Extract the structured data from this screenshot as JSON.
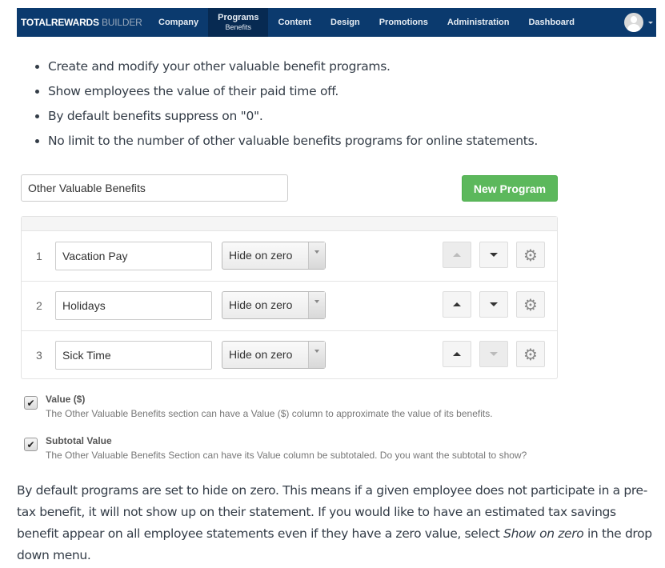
{
  "navbar": {
    "brand_primary": "TOTALREWARDS",
    "brand_secondary": "BUILDER",
    "items": [
      {
        "label": "Company"
      },
      {
        "label": "Programs",
        "sublabel": "Benefits",
        "active": true
      },
      {
        "label": "Content"
      },
      {
        "label": "Design"
      },
      {
        "label": "Promotions"
      },
      {
        "label": "Administration"
      },
      {
        "label": "Dashboard"
      }
    ]
  },
  "bullets": [
    "Create and modify your other valuable benefit programs.",
    "Show employees the value of their paid time off.",
    "By default benefits suppress on \"0\".",
    "No limit to the number of other valuable benefits programs for online statements."
  ],
  "section": {
    "name_value": "Other Valuable Benefits",
    "new_program_label": "New Program"
  },
  "programs": [
    {
      "index": "1",
      "name": "Vacation Pay",
      "visibility": "Hide on zero",
      "up_enabled": false,
      "down_enabled": true
    },
    {
      "index": "2",
      "name": "Holidays",
      "visibility": "Hide on zero",
      "up_enabled": true,
      "down_enabled": true
    },
    {
      "index": "3",
      "name": "Sick Time",
      "visibility": "Hide on zero",
      "up_enabled": true,
      "down_enabled": false
    }
  ],
  "options": [
    {
      "title": "Value ($)",
      "description": "The Other Valuable Benefits section can have a Value ($) column to approximate the value of its benefits.",
      "checked": true
    },
    {
      "title": "Subtotal Value",
      "description": "The Other Valuable Benefits Section can have its Value column be subtotaled. Do you want the subtotal to show?",
      "checked": true
    }
  ],
  "footer_paragraph": {
    "text_before": "By default programs are set to hide on zero. This means if a given employee does not participate in a pre-tax benefit, it will not show up on their statement. If you would like to have an estimated tax savings benefit appear on all employee statements even if they have a zero value, select ",
    "emphasis": "Show on zero",
    "text_after": " in the drop down menu."
  },
  "icons": {
    "check": "✔",
    "gear": "⚙"
  }
}
